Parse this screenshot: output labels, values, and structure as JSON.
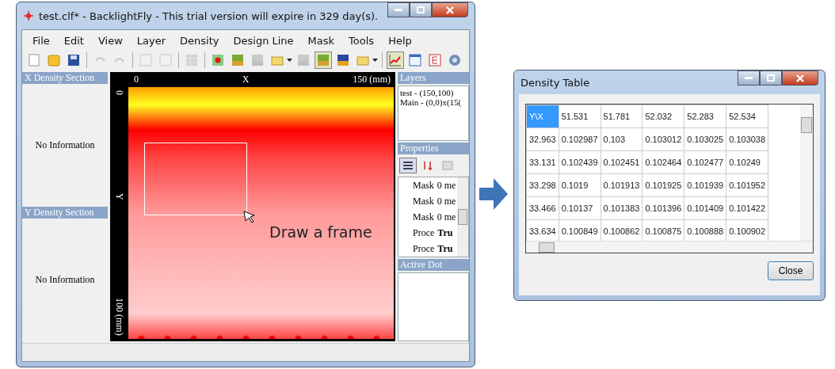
{
  "main_window": {
    "title": "test.clf* - BacklightFly - This trial version will expire in 329 day(s).",
    "menu": [
      "File",
      "Edit",
      "View",
      "Layer",
      "Density",
      "Design Line",
      "Mask",
      "Tools",
      "Help"
    ],
    "toolbar": [
      {
        "kind": "new",
        "disabled": false,
        "pressed": false
      },
      {
        "kind": "open",
        "disabled": false,
        "pressed": false
      },
      {
        "kind": "save",
        "disabled": false,
        "pressed": false
      },
      {
        "kind": "sep"
      },
      {
        "kind": "undo",
        "disabled": true,
        "pressed": false
      },
      {
        "kind": "redo",
        "disabled": true,
        "pressed": false
      },
      {
        "kind": "sep"
      },
      {
        "kind": "frame",
        "disabled": true,
        "pressed": false
      },
      {
        "kind": "frame",
        "disabled": true,
        "pressed": false
      },
      {
        "kind": "sep"
      },
      {
        "kind": "grid",
        "disabled": true,
        "pressed": false
      },
      {
        "kind": "sep"
      },
      {
        "kind": "dot",
        "disabled": false,
        "pressed": false
      },
      {
        "kind": "image",
        "disabled": false,
        "pressed": false
      },
      {
        "kind": "image",
        "disabled": true,
        "pressed": false
      },
      {
        "kind": "folder",
        "disabled": false,
        "pressed": false
      },
      {
        "kind": "caret"
      },
      {
        "kind": "image",
        "disabled": true,
        "pressed": false
      },
      {
        "kind": "image",
        "disabled": false,
        "pressed": true
      },
      {
        "kind": "df",
        "disabled": false,
        "pressed": false
      },
      {
        "kind": "folder",
        "disabled": false,
        "pressed": false
      },
      {
        "kind": "caret"
      },
      {
        "kind": "sep"
      },
      {
        "kind": "chart",
        "disabled": false,
        "pressed": true
      },
      {
        "kind": "window",
        "disabled": false,
        "pressed": false
      },
      {
        "kind": "doc",
        "disabled": false,
        "pressed": false
      },
      {
        "kind": "gear",
        "disabled": false,
        "pressed": false
      }
    ],
    "x_section": {
      "title": "X Density Section",
      "message": "No Information"
    },
    "y_section": {
      "title": "Y Density Section",
      "message": "No Information"
    },
    "canvas": {
      "x_start": "0",
      "x_label": "X",
      "x_end": "150 (mm)",
      "y_start": "0",
      "y_label": "Y",
      "y_end": "100 (mm)",
      "annotation": "Draw a frame"
    },
    "layers": {
      "title": "Layers",
      "items": [
        "test - (150,100)",
        "Main - (0,0)x(15("
      ]
    },
    "properties": {
      "title": "Properties",
      "rows": [
        {
          "name": "Mask",
          "value": "0 me",
          "bold": false
        },
        {
          "name": "Mask",
          "value": "0 me",
          "bold": false
        },
        {
          "name": "Mask",
          "value": "0 me",
          "bold": false
        },
        {
          "name": "Proce",
          "value": "Tru",
          "bold": true
        },
        {
          "name": "Proce",
          "value": "Tru",
          "bold": true
        }
      ]
    },
    "active_dot": {
      "title": "Active Dot"
    }
  },
  "density_table": {
    "title": "Density Table",
    "columns": [
      {
        "label": "Y\\X",
        "selected": true
      },
      {
        "label": "51.531",
        "selected": false
      },
      {
        "label": "51.781",
        "selected": false
      },
      {
        "label": "52.032",
        "selected": false
      },
      {
        "label": "52.283",
        "selected": false
      },
      {
        "label": "52.534",
        "selected": false
      }
    ],
    "rows": [
      [
        "32.963",
        "0.102987",
        "0.103",
        "0.103012",
        "0.103025",
        "0.103038"
      ],
      [
        "33.131",
        "0.102439",
        "0.102451",
        "0.102464",
        "0.102477",
        "0.10249"
      ],
      [
        "33.298",
        "0.1019",
        "0.101913",
        "0.101925",
        "0.101939",
        "0.101952"
      ],
      [
        "33.466",
        "0.10137",
        "0.101383",
        "0.101396",
        "0.101409",
        "0.101422"
      ],
      [
        "33.634",
        "0.100849",
        "0.100862",
        "0.100875",
        "0.100888",
        "0.100902"
      ]
    ],
    "button": "Close"
  }
}
